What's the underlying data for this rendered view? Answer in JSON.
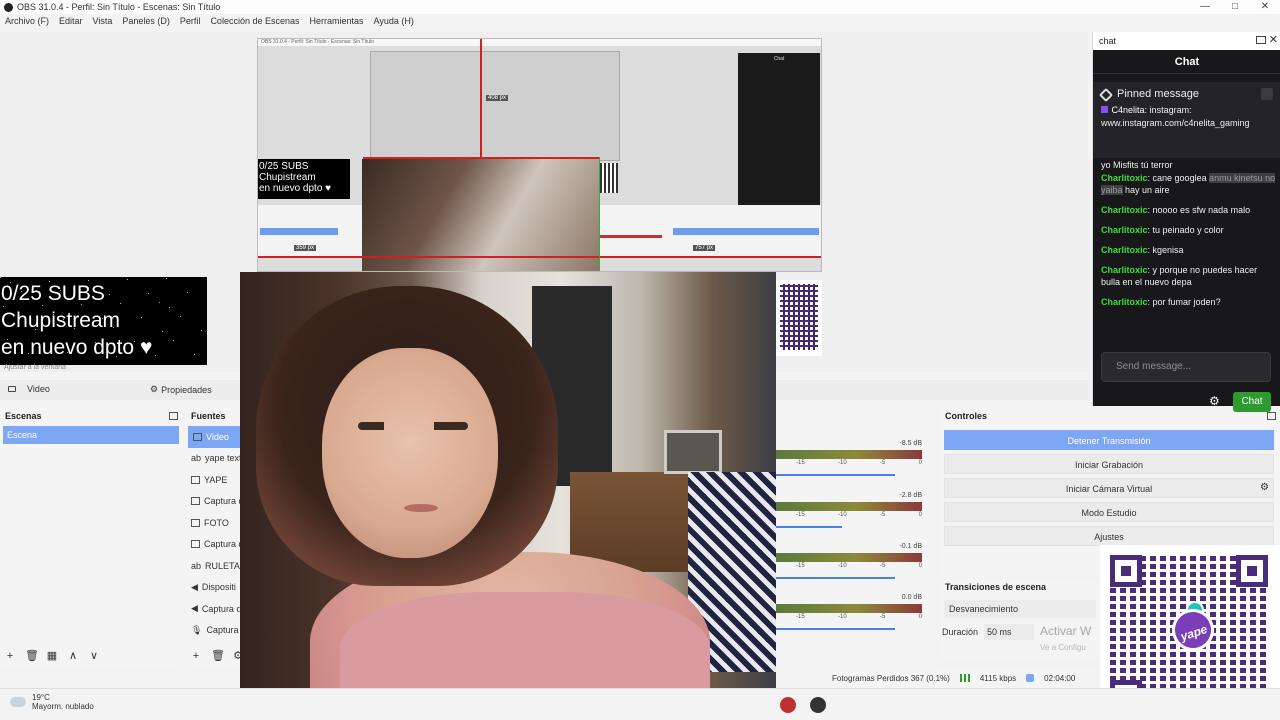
{
  "window": {
    "title": "OBS 31.0.4 - Perfil: Sin Título - Escenas: Sin Título",
    "controls": {
      "minimize": "—",
      "maximize": "□",
      "close": "✕"
    }
  },
  "menu": [
    "Archivo (F)",
    "Editar",
    "Vista",
    "Paneles (D)",
    "Perfil",
    "Colección de Escenas",
    "Herramientas",
    "Ayuda (H)"
  ],
  "overlay": {
    "line1": "0/25 SUBS",
    "line2": "Chupistream",
    "line3": "en nuevo dpto ♥"
  },
  "nested_preview": {
    "title": "OBS 31.0.4 - Perfil: Sin Título - Escenas: Sin Título",
    "overlay_line1": "0/25 SUBS",
    "overlay_line2": "Chupistream",
    "overlay_line3": "en nuevo dpto ♥",
    "px_left": "359 px",
    "px_right": "757 px",
    "px_top": "408 px",
    "chat_title": "Chat"
  },
  "fit_label": "Ajustar a la ventana",
  "toolbar": {
    "source_label": "Video",
    "properties_label": "Propiedades"
  },
  "scenes": {
    "title": "Escenas",
    "items": [
      "Escena"
    ]
  },
  "sources": {
    "title": "Fuentes",
    "items": [
      {
        "icon": "camera-icon",
        "label": "Video"
      },
      {
        "icon": "text-icon",
        "label": "yape text"
      },
      {
        "icon": "image-icon",
        "label": "YAPE"
      },
      {
        "icon": "window-icon",
        "label": "Captura d"
      },
      {
        "icon": "image-icon",
        "label": "FOTO"
      },
      {
        "icon": "window-icon",
        "label": "Captura d"
      },
      {
        "icon": "text-icon",
        "label": "RULETA"
      },
      {
        "icon": "speaker-icon",
        "label": "Dispositi"
      },
      {
        "icon": "speaker-icon",
        "label": "Captura d"
      },
      {
        "icon": "mic-icon",
        "label": "Captura d"
      }
    ],
    "footer": [
      "+",
      "🗑",
      "⚙"
    ]
  },
  "mixer": {
    "channels": [
      {
        "db": "-8.5 dB",
        "slider": 0.9
      },
      {
        "db": "-2.8 dB",
        "slider": 0.5
      },
      {
        "db": "-0.1 dB",
        "slider": 0.9
      },
      {
        "db": "0.0 dB",
        "slider": 0.9
      }
    ],
    "scale": [
      "-15",
      "-10",
      "-5",
      "0"
    ]
  },
  "controls": {
    "title": "Controles",
    "buttons": [
      "Detener Transmisión",
      "Iniciar Grabación",
      "Iniciar Cámara Virtual",
      "Modo Estudio",
      "Ajustes"
    ]
  },
  "transitions": {
    "title": "Transiciones de escena",
    "selected": "Desvanecimiento",
    "duration_label": "Duración",
    "duration_value": "50 ms"
  },
  "activate": {
    "line1": "Activar W",
    "line2": "Ve a Configu"
  },
  "status": {
    "frames_dropped": "Fotogramas Perdidos 367 (0.1%)",
    "bitrate": "4115 kbps",
    "time": "02:04:00"
  },
  "chat": {
    "dock_title": "chat",
    "header": "Chat",
    "pinned_label": "Pinned message",
    "pinned_user": "C4nelita",
    "pinned_text": "instagram: www.instagram.com/c4nelita_gaming",
    "partial_line": "yo Misfits tú terror",
    "messages": [
      {
        "author": "Charlitoxic",
        "text": "cane googlea",
        "hl": "anmu kinetsu no yaiba",
        "tail": "hay un aire"
      },
      {
        "author": "Charlitoxic",
        "text": "noooo es sfw nada malo"
      },
      {
        "author": "Charlitoxic",
        "text": "tu peinado y color"
      },
      {
        "author": "Charlitoxic",
        "text": "kgenisa"
      },
      {
        "author": "Charlitoxic",
        "text": "y porque no puedes hacer bulla en el nuevo depa"
      },
      {
        "author": "Charlitoxic",
        "text": "por fumar joden?"
      }
    ],
    "input_placeholder": "Send message...",
    "send_label": "Chat"
  },
  "taskbar": {
    "temp": "19°C",
    "weather": "Mayorm. nublado"
  },
  "qr_label": "yape",
  "colors": {
    "accent": "#7da7f5",
    "twitch_bg": "#18181b",
    "chat_author": "#3ddc3d",
    "send_green": "#2d9b2d",
    "yape_purple": "#7a3fb8"
  }
}
